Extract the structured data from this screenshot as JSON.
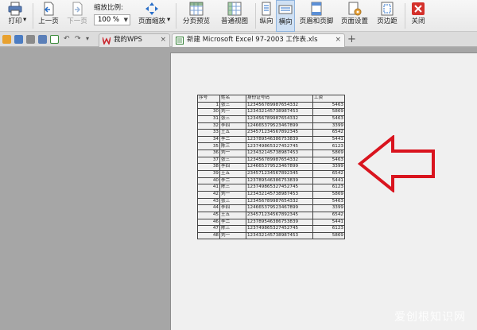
{
  "toolbar": {
    "print": "打印",
    "prev_page": "上一页",
    "next_page": "下一页",
    "zoom_ratio_label": "缩放比例:",
    "zoom_value": "100 %",
    "page_zoom": "页面缩放",
    "page_break_preview": "分页预览",
    "normal_view": "普通视图",
    "portrait": "纵向",
    "landscape": "横向",
    "header_footer": "页眉和页脚",
    "page_setup": "页面设置",
    "margins": "页边距",
    "close": "关闭"
  },
  "tabs": {
    "wps": "我的WPS",
    "doc": "新建 Microsoft Excel 97-2003 工作表.xls"
  },
  "sheet": {
    "headers": [
      "序号",
      "姓名",
      "身份证号码",
      "工资"
    ],
    "rows": [
      [
        "1",
        "张三",
        "123456789987654332",
        "5463"
      ],
      [
        "30",
        "刘一",
        "123432145738987453",
        "5869"
      ],
      [
        "31",
        "张三",
        "123456789987654332",
        "5463"
      ],
      [
        "32",
        "李四",
        "124665379523467899",
        "3399"
      ],
      [
        "33",
        "王五",
        "234571234567892345",
        "6542"
      ],
      [
        "34",
        "李二",
        "123789546386753839",
        "5441"
      ],
      [
        "35",
        "陈三",
        "123749865327452745",
        "6123"
      ],
      [
        "36",
        "刘一",
        "123432145738987453",
        "5869"
      ],
      [
        "37",
        "张三",
        "123456789987654332",
        "5463"
      ],
      [
        "38",
        "李四",
        "124665379523467899",
        "3399"
      ],
      [
        "39",
        "王五",
        "234571234567892345",
        "6542"
      ],
      [
        "40",
        "李二",
        "123789546386753839",
        "5441"
      ],
      [
        "41",
        "陈三",
        "123749865327452745",
        "6123"
      ],
      [
        "42",
        "刘一",
        "123432145738987453",
        "5869"
      ],
      [
        "43",
        "张三",
        "123456789987654332",
        "5463"
      ],
      [
        "44",
        "李四",
        "124665379523467899",
        "3399"
      ],
      [
        "45",
        "王五",
        "234571234567892345",
        "6542"
      ],
      [
        "46",
        "李二",
        "123789546386753839",
        "5441"
      ],
      [
        "47",
        "陈三",
        "123749865327452745",
        "6123"
      ],
      [
        "48",
        "刘一",
        "123432145738987453",
        "5869"
      ]
    ]
  },
  "watermark": "爱创根知识网",
  "colors": {
    "arrow": "#d9141e",
    "page_bg": "#f0f0f0",
    "workspace_bg": "#a6a6a6",
    "wps_red": "#c9252c"
  },
  "icons": [
    "print-icon",
    "prev-page-icon",
    "next-page-icon",
    "page-zoom-icon",
    "page-break-preview-icon",
    "normal-view-icon",
    "portrait-icon",
    "landscape-icon",
    "header-footer-icon",
    "page-setup-icon",
    "margins-icon",
    "close-icon"
  ]
}
